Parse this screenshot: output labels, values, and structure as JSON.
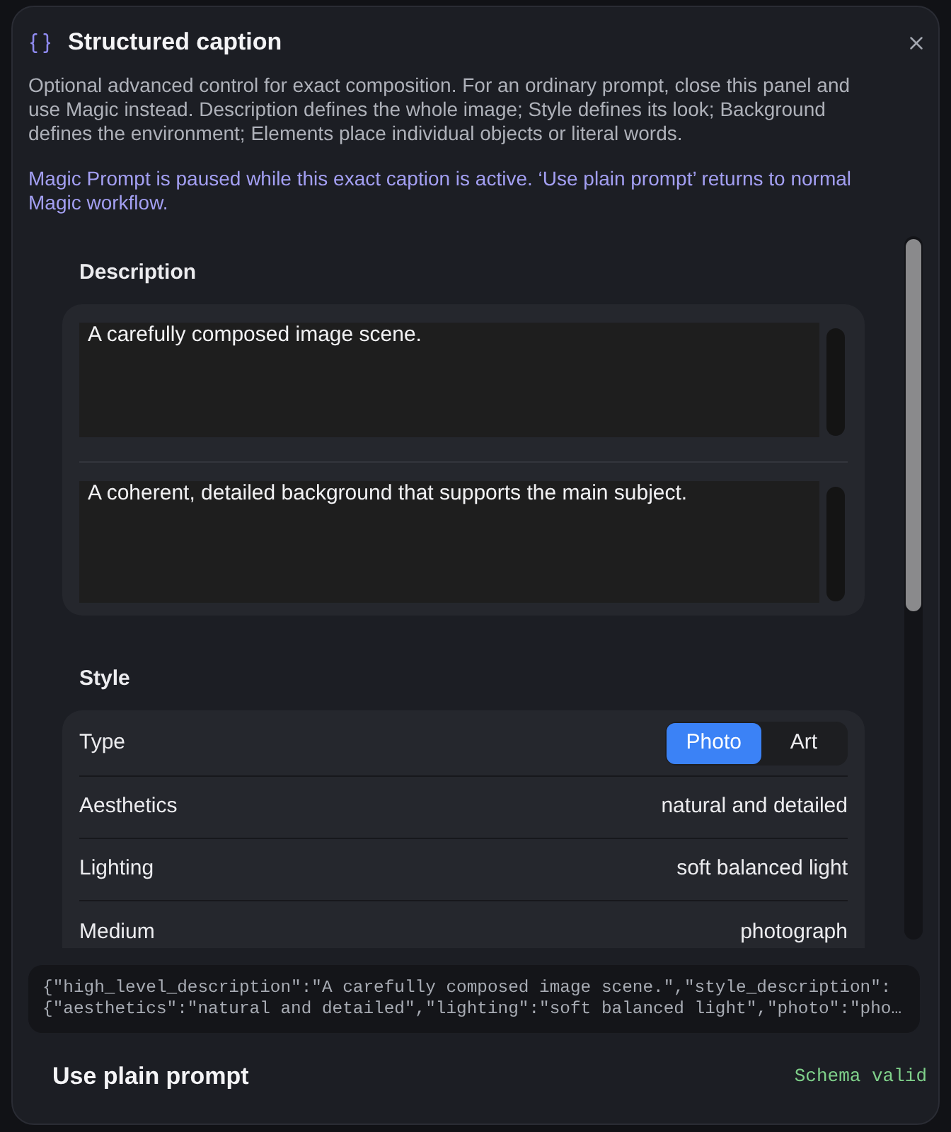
{
  "dialog": {
    "title": "Structured caption",
    "intro": "Optional advanced control for exact composition. For an ordinary prompt, close this panel and use Magic instead. Description defines the whole image; Style defines its look; Background defines the environment; Elements place individual objects or literal words.",
    "notice": "Magic Prompt is paused while this exact caption is active. ‘Use plain prompt’ returns to normal Magic workflow."
  },
  "sections": [
    {
      "kind": "text_fields",
      "heading": "Description",
      "fields": [
        {
          "value": "A carefully composed image scene."
        },
        {
          "value": "A coherent, detailed background that supports the main subject."
        }
      ]
    },
    {
      "kind": "properties",
      "heading": "Style",
      "rows": [
        {
          "kind": "segmented",
          "label": "Type",
          "options": [
            {
              "label": "Photo",
              "selected": true
            },
            {
              "label": "Art",
              "selected": false
            }
          ]
        },
        {
          "kind": "value",
          "label": "Aesthetics",
          "value": "natural and detailed"
        },
        {
          "kind": "value",
          "label": "Lighting",
          "value": "soft balanced light"
        },
        {
          "kind": "value",
          "label": "Medium",
          "value": "photograph"
        }
      ]
    }
  ],
  "json_preview": {
    "lines": [
      "{\"high_level_description\":\"A carefully composed image scene.\",\"style_description\":",
      "{\"aesthetics\":\"natural and detailed\",\"lighting\":\"soft balanced light\",\"photo\":\"pho…"
    ]
  },
  "footer": {
    "plain_prompt_button": "Use plain prompt",
    "schema_status": "Schema valid"
  }
}
